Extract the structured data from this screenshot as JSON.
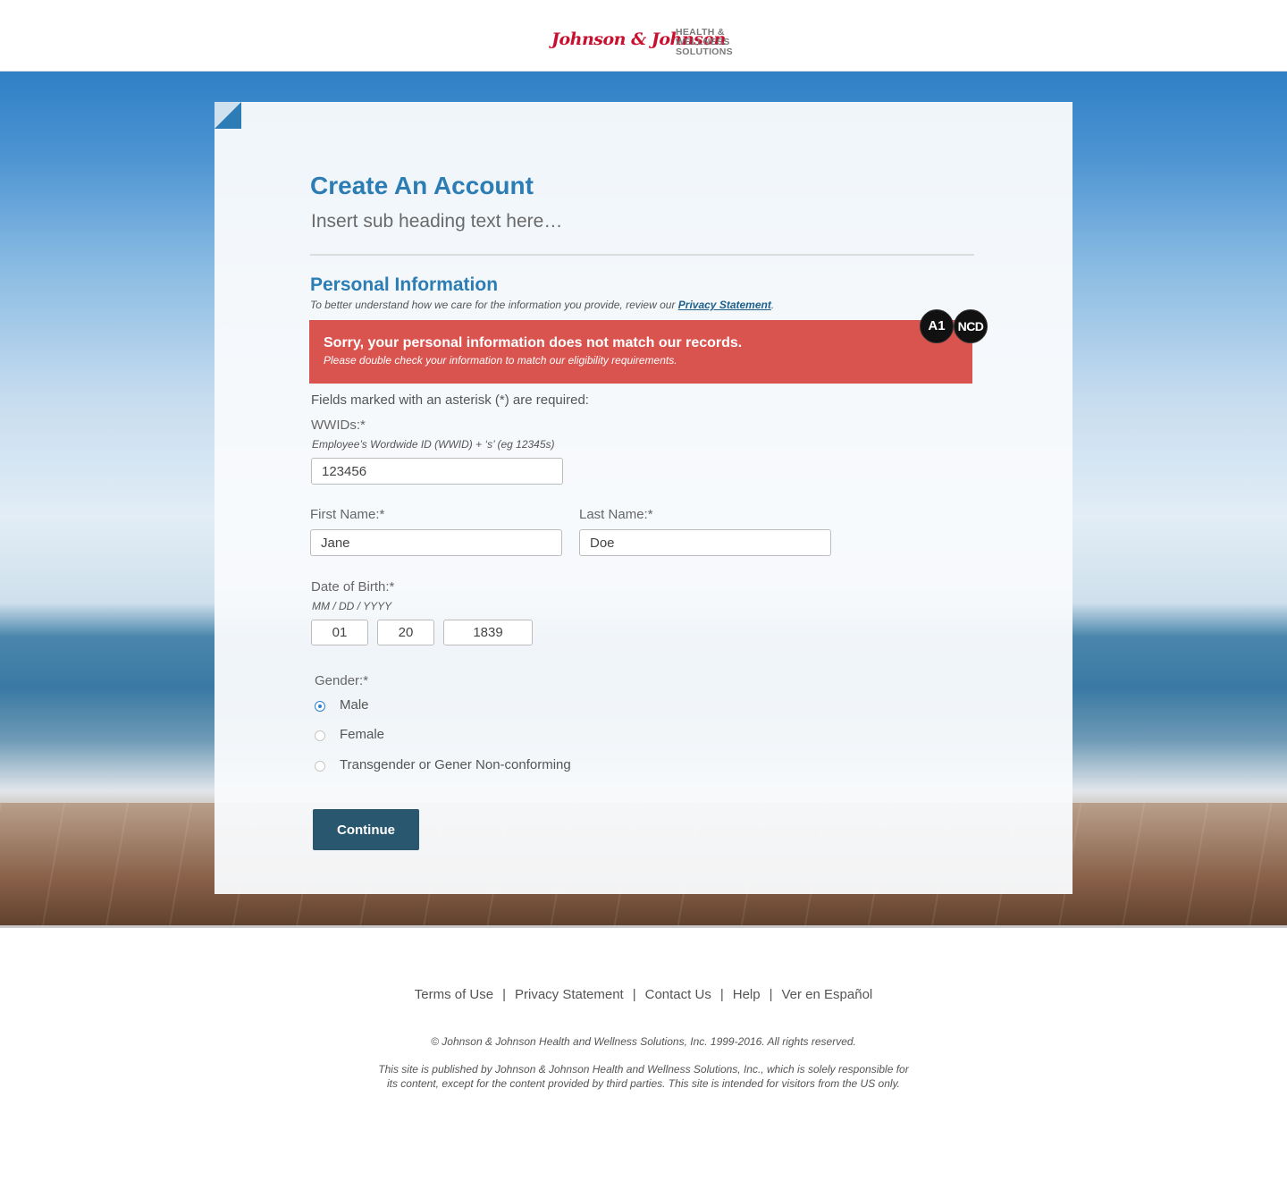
{
  "header": {
    "logo_script": "Johnson & Johnson",
    "logo_line1": "HEALTH &",
    "logo_line2": "WELLNESS",
    "logo_line3": "SOLUTIONS"
  },
  "card": {
    "title": "Create An Account",
    "subtitle": "Insert sub heading text here…"
  },
  "section": {
    "title": "Personal Information",
    "note_prefix": "To better understand how we care for the information you provide, review our ",
    "note_link": "Privacy Statement",
    "note_suffix": "."
  },
  "alert": {
    "title": "Sorry, your personal information does not match our records.",
    "text": "Please double check your information to match our eligibility requirements."
  },
  "badges": {
    "a1": "A1",
    "ncd": "NCD"
  },
  "form": {
    "required_note": "Fields marked with an asterisk (*) are required:",
    "wwid": {
      "label": "WWIDs:*",
      "hint": "Employee’s Wordwide ID (WWID) + ‘s’ (eg 12345s)",
      "value": "123456"
    },
    "first_name": {
      "label": "First Name:*",
      "value": "Jane"
    },
    "last_name": {
      "label": "Last Name:*",
      "value": "Doe"
    },
    "dob": {
      "label": "Date of Birth:*",
      "hint": "MM / DD / YYYY",
      "month": "01",
      "day": "20",
      "year": "1839"
    },
    "gender": {
      "label": "Gender:*",
      "options": [
        {
          "label": "Male",
          "checked": true
        },
        {
          "label": "Female",
          "checked": false
        },
        {
          "label": "Transgender or Gener Non-conforming",
          "checked": false
        }
      ]
    },
    "continue_label": "Continue"
  },
  "footer": {
    "links": [
      "Terms of Use",
      "Privacy Statement",
      "Contact Us",
      "Help",
      "Ver en Español"
    ],
    "separator": "|",
    "copyright": "© Johnson & Johnson Health and Wellness Solutions, Inc. 1999-2016. All rights reserved.",
    "disclaimer": "This site is published by Johnson & Johnson Health and Wellness Solutions, Inc., which is solely responsible for its content, except for the content provided by third parties.  This site is intended for visitors from the US only."
  }
}
